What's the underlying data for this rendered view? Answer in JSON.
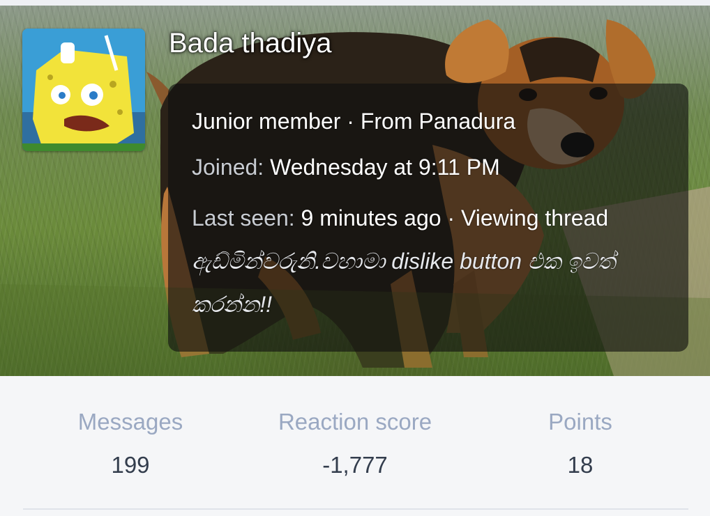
{
  "profile": {
    "username": "Bada thadiya",
    "avatar_icon": "spongebob-meme-avatar",
    "role": "Junior member",
    "location_sep": " · ",
    "location": "From Panadura",
    "joined_label": "Joined:",
    "joined_value": "Wednesday at 9:11 PM",
    "last_seen_label": "Last seen:",
    "last_seen_value": "9 minutes ago",
    "activity_sep": " · ",
    "activity": "Viewing thread",
    "thread_title": "ඇඩ්මින්වරුනි.වහාමා dislike button එක ඉවත් කරන්න!!"
  },
  "stats": {
    "messages_label": "Messages",
    "messages_value": "199",
    "reaction_label": "Reaction score",
    "reaction_value": "-1,777",
    "points_label": "Points",
    "points_value": "18"
  },
  "colors": {
    "stat_label": "#9aa8c2",
    "stat_value": "#333d4d",
    "info_box_bg": "rgba(15,15,15,0.62)"
  }
}
